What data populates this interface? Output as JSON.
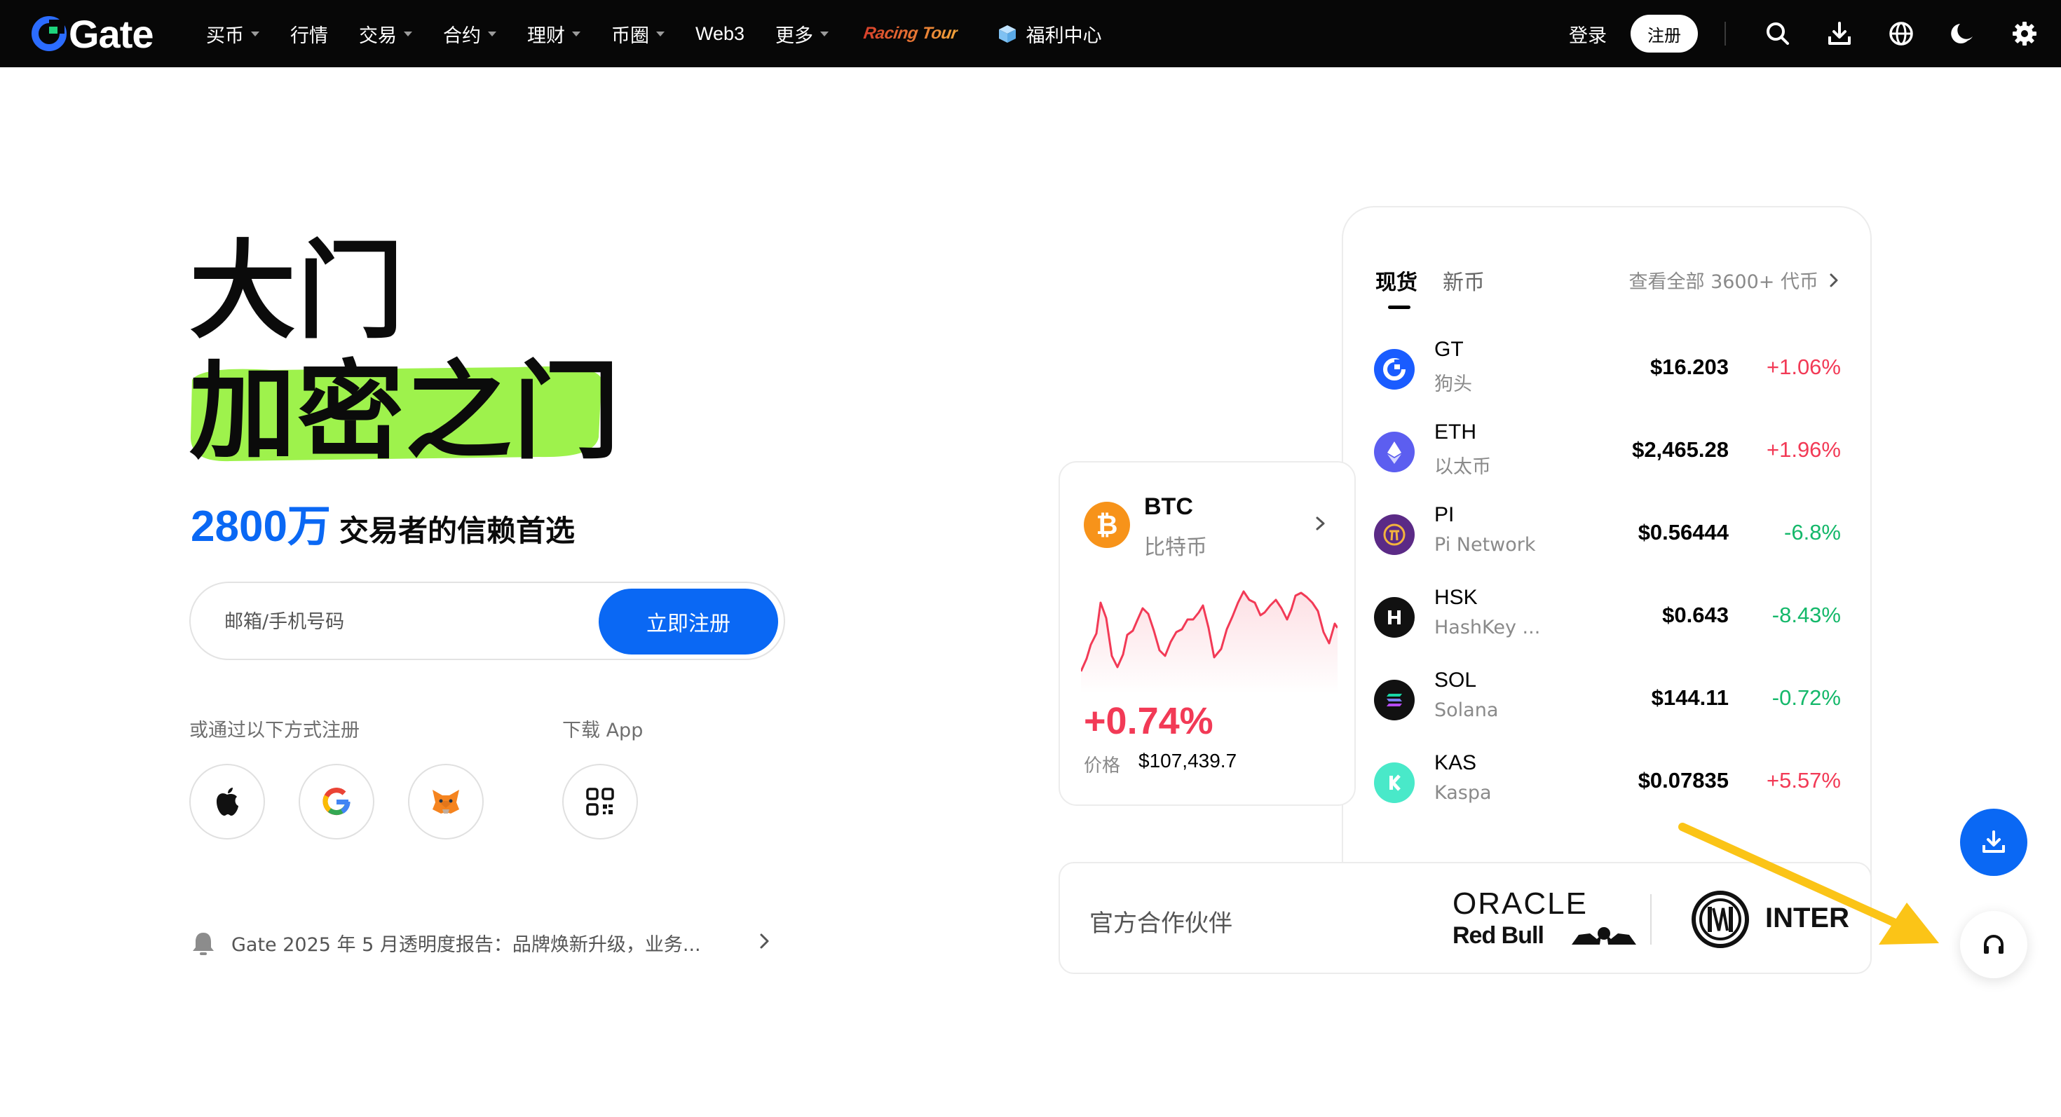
{
  "colors": {
    "brand_blue": "#0a68f4",
    "highlight_green": "#9ef24c",
    "up_red": "#f23a56",
    "down_green": "#14b86a",
    "annotation_yellow": "#fbc417"
  },
  "nav": {
    "logo": "Gate",
    "items": [
      {
        "label": "买币",
        "caret": true
      },
      {
        "label": "行情",
        "caret": false
      },
      {
        "label": "交易",
        "caret": true
      },
      {
        "label": "合约",
        "caret": true
      },
      {
        "label": "理财",
        "caret": true
      },
      {
        "label": "币圈",
        "caret": true
      },
      {
        "label": "Web3",
        "caret": false
      },
      {
        "label": "更多",
        "caret": true
      }
    ],
    "racing_tour": "Racing Tour",
    "welfare": "福利中心",
    "login": "登录",
    "signup": "注册",
    "icons": [
      "search-icon",
      "download-icon",
      "globe-icon",
      "moon-icon",
      "gear-icon"
    ]
  },
  "hero": {
    "line1": "大门",
    "line2": "加密之门",
    "sub_number": "2800万",
    "sub_text": "交易者的信赖首选",
    "input_placeholder": "邮箱/手机号码",
    "cta": "立即注册",
    "other_signup_label": "或通过以下方式注册",
    "download_label": "下载 App",
    "social_icons": [
      "apple-icon",
      "google-icon",
      "metamask-icon"
    ],
    "notice": "Gate 2025 年 5 月透明度报告：品牌焕新升级，业务..."
  },
  "market": {
    "tabs": [
      "现货",
      "新币"
    ],
    "view_all": "查看全部 3600+ 代币",
    "coins": [
      {
        "symbol": "GT",
        "name": "狗头",
        "price": "$16.203",
        "change": "+1.06%",
        "dir": "up"
      },
      {
        "symbol": "ETH",
        "name": "以太币",
        "price": "$2,465.28",
        "change": "+1.96%",
        "dir": "up"
      },
      {
        "symbol": "PI",
        "name": "Pi Network",
        "price": "$0.56444",
        "change": "-6.8%",
        "dir": "down"
      },
      {
        "symbol": "HSK",
        "name": "HashKey ...",
        "price": "$0.643",
        "change": "-8.43%",
        "dir": "down"
      },
      {
        "symbol": "SOL",
        "name": "Solana",
        "price": "$144.11",
        "change": "-0.72%",
        "dir": "down"
      },
      {
        "symbol": "KAS",
        "name": "Kaspa",
        "price": "$0.07835",
        "change": "+5.57%",
        "dir": "up"
      }
    ]
  },
  "btc": {
    "symbol": "BTC",
    "name": "比特币",
    "change": "+0.74%",
    "price_label": "价格",
    "price": "$107,439.7"
  },
  "partners": {
    "label": "官方合作伙伴",
    "oracle": "ORACLE",
    "redbull": "Red Bull",
    "inter": "INTER"
  }
}
